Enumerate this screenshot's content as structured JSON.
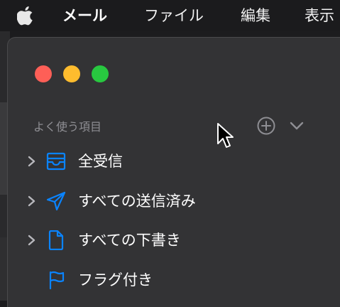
{
  "menubar": {
    "apple_icon": "apple-logo-icon",
    "app_name": "メール",
    "items": [
      "ファイル",
      "編集",
      "表示"
    ]
  },
  "window": {
    "controls": [
      "close",
      "minimize",
      "zoom"
    ],
    "sidebar": {
      "section_title": "よく使う項目",
      "add_icon": "plus-circle-icon",
      "collapse_icon": "chevron-down-icon",
      "items": [
        {
          "label": "全受信",
          "icon": "tray-icon",
          "expandable": true
        },
        {
          "label": "すべての送信済み",
          "icon": "paperplane-icon",
          "expandable": true
        },
        {
          "label": "すべての下書き",
          "icon": "document-icon",
          "expandable": true
        },
        {
          "label": "フラグ付き",
          "icon": "flag-icon",
          "expandable": false
        }
      ]
    }
  },
  "colors": {
    "accent": "#0a84ff",
    "close": "#fe5f57",
    "minimize": "#febc2e",
    "zoom": "#28c840",
    "sidebar_bg": "#333335",
    "menubar_bg": "#1b1b1d"
  }
}
